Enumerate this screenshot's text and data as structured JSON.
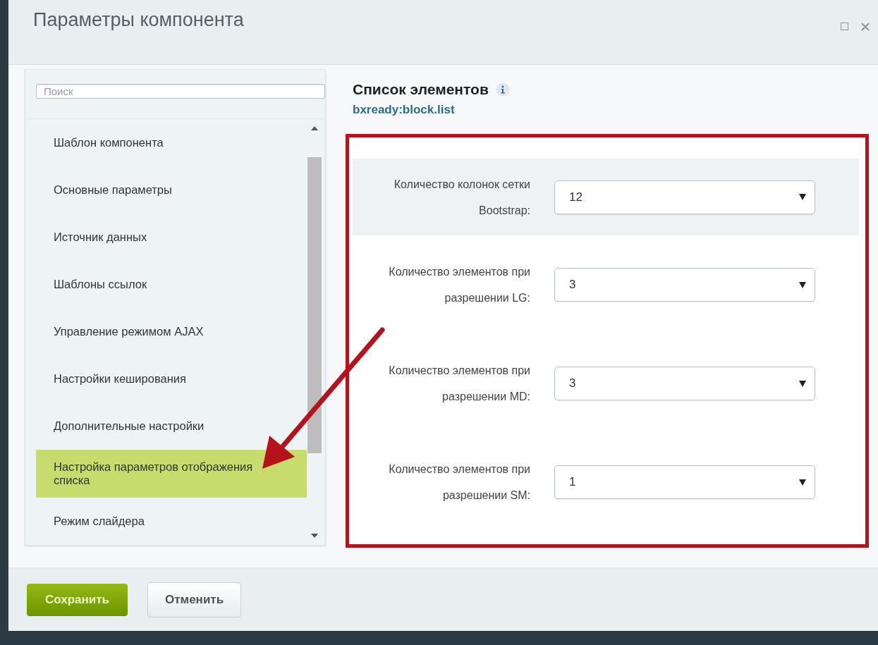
{
  "window": {
    "title": "Параметры компонента"
  },
  "sidebar": {
    "search": {
      "placeholder": "Поиск"
    },
    "items": [
      {
        "label": "Шаблон компонента",
        "selected": false
      },
      {
        "label": "Основные параметры",
        "selected": false
      },
      {
        "label": "Источник данных",
        "selected": false
      },
      {
        "label": "Шаблоны ссылок",
        "selected": false
      },
      {
        "label": "Управление режимом AJAX",
        "selected": false
      },
      {
        "label": "Настройки кеширования",
        "selected": false
      },
      {
        "label": "Дополнительные настройки",
        "selected": false
      },
      {
        "label": "Настройка параметров отображения списка",
        "selected": true
      },
      {
        "label": "Режим слайдера",
        "selected": false
      }
    ]
  },
  "component": {
    "title": "Список элементов",
    "code": "bxready:block.list"
  },
  "fields": [
    {
      "label": "Количество колонок сетки Bootstrap:",
      "value": "12",
      "highlighted": true
    },
    {
      "label": "Количество элементов при разрешении LG:",
      "value": "3",
      "highlighted": false
    },
    {
      "label": "Количество элементов при разрешении MD:",
      "value": "3",
      "highlighted": false
    },
    {
      "label": "Количество элементов при разрешении SM:",
      "value": "1",
      "highlighted": false
    }
  ],
  "buttons": [
    {
      "label": "Сохранить",
      "kind": "primary"
    },
    {
      "label": "Отменить",
      "kind": "secondary"
    }
  ]
}
